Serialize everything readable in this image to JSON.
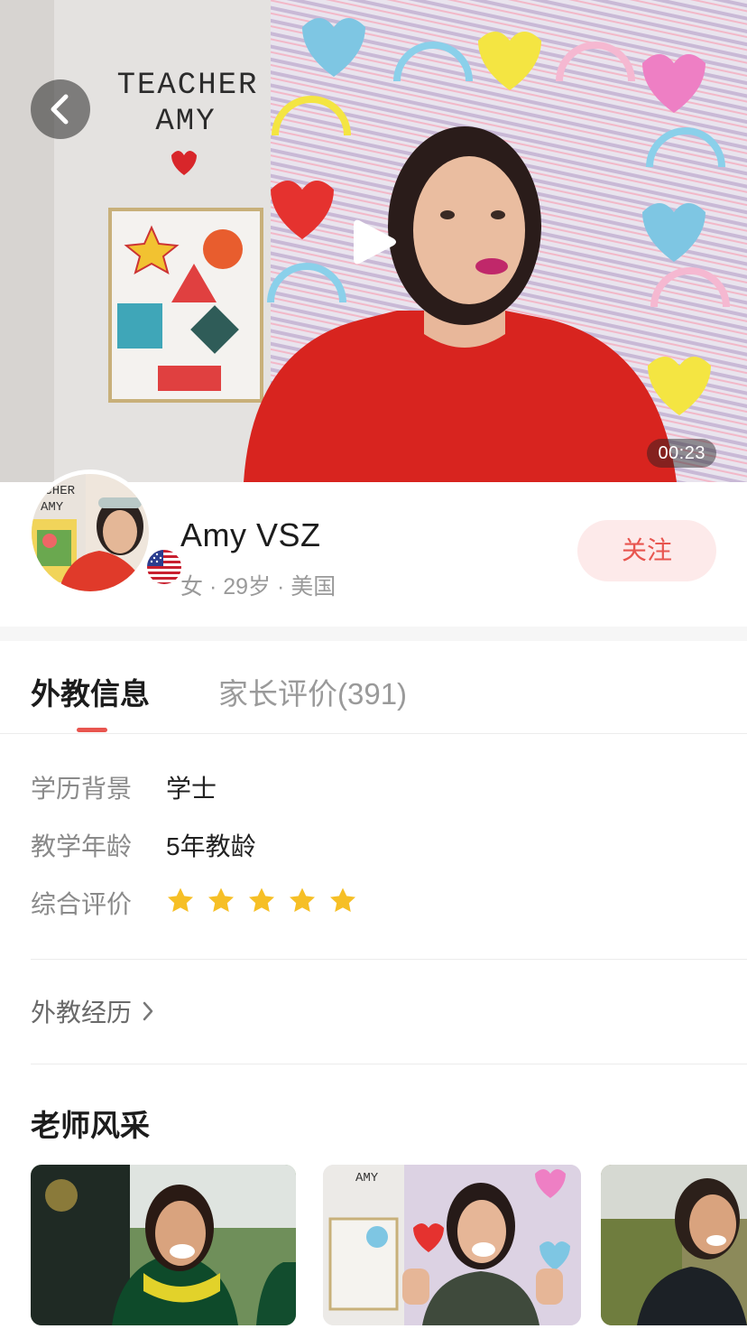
{
  "video": {
    "duration": "00:23",
    "board_text_line1": "TEACHER",
    "board_text_line2": "AMY",
    "icons": {
      "back": "chevron-left-icon",
      "play": "play-icon"
    }
  },
  "profile": {
    "name": "Amy VSZ",
    "meta": "女 · 29岁 · 美国",
    "follow_label": "关注",
    "flag": "us-flag-icon"
  },
  "tabs": [
    {
      "label": "外教信息",
      "active": true
    },
    {
      "label": "家长评价(391)",
      "active": false
    }
  ],
  "info": {
    "education": {
      "label": "学历背景",
      "value": "学士"
    },
    "teaching_years": {
      "label": "教学年龄",
      "value": "5年教龄"
    },
    "rating": {
      "label": "综合评价",
      "stars": 5,
      "max": 5
    }
  },
  "experience_link": "外教经历",
  "gallery": {
    "title": "老师风采",
    "photos": [
      "graduation-photo",
      "classroom-thumbs-up-photo",
      "outdoor-photo"
    ]
  },
  "colors": {
    "accent": "#e8554f",
    "follow_bg": "#fdeaea",
    "star": "#f6bf26"
  }
}
